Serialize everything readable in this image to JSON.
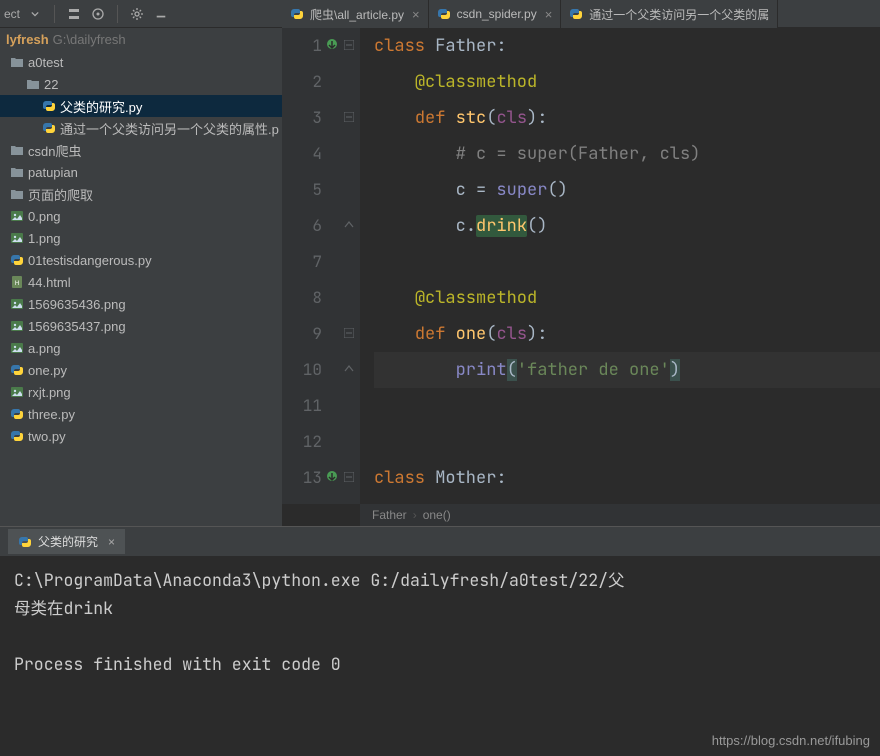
{
  "toolbar": {
    "project_suffix": "ect"
  },
  "tabs": [
    {
      "label": "爬虫\\all_article.py",
      "icon": "python",
      "closable": true
    },
    {
      "label": "csdn_spider.py",
      "icon": "python",
      "closable": true
    },
    {
      "label": "通过一个父类访问另一个父类的属",
      "icon": "python",
      "closable": false
    }
  ],
  "project": {
    "root_name": "lyfresh",
    "root_path": "G:\\dailyfresh",
    "tree": [
      {
        "indent": 0,
        "icon": "folder",
        "label": "a0test"
      },
      {
        "indent": 1,
        "icon": "folder",
        "label": "22"
      },
      {
        "indent": 2,
        "icon": "python",
        "label": "父类的研究.py",
        "selected": true
      },
      {
        "indent": 2,
        "icon": "python",
        "label": "通过一个父类访问另一个父类的属性.p"
      },
      {
        "indent": 0,
        "icon": "folder",
        "label": "csdn爬虫"
      },
      {
        "indent": 0,
        "icon": "folder",
        "label": "patupian"
      },
      {
        "indent": 0,
        "icon": "folder",
        "label": "页面的爬取"
      },
      {
        "indent": 0,
        "icon": "image",
        "label": "0.png"
      },
      {
        "indent": 0,
        "icon": "image",
        "label": "1.png"
      },
      {
        "indent": 0,
        "icon": "python",
        "label": "01testisdangerous.py"
      },
      {
        "indent": 0,
        "icon": "html",
        "label": "44.html"
      },
      {
        "indent": 0,
        "icon": "image",
        "label": "1569635436.png"
      },
      {
        "indent": 0,
        "icon": "image",
        "label": "1569635437.png"
      },
      {
        "indent": 0,
        "icon": "image",
        "label": "a.png"
      },
      {
        "indent": 0,
        "icon": "python",
        "label": "one.py"
      },
      {
        "indent": 0,
        "icon": "image",
        "label": "rxjt.png"
      },
      {
        "indent": 0,
        "icon": "python",
        "label": "three.py"
      },
      {
        "indent": 0,
        "icon": "python",
        "label": "two.py"
      }
    ]
  },
  "code": {
    "gutter_first": 1,
    "lines": [
      {
        "n": 1,
        "mark": "impl",
        "fold": "minus",
        "html": "<span class='k'>class</span> <span class='pa'>Father</span><span class='pu'>:</span>"
      },
      {
        "n": 2,
        "html": "    <span class='dec'>@classmethod</span>"
      },
      {
        "n": 3,
        "fold": "minus",
        "html": "    <span class='k'>def</span> <span class='fn'>stc</span><span class='pu'>(</span><span class='se'>cls</span><span class='pu'>):</span>"
      },
      {
        "n": 4,
        "html": "        <span class='cm'># c = super(Father, cls)</span>"
      },
      {
        "n": 5,
        "html": "        <span class='pa'>c</span> <span class='op'>=</span> <span class='bi'>super</span><span class='pu'>()</span>"
      },
      {
        "n": 6,
        "fold": "up",
        "html": "        <span class='pa'>c</span><span class='pu'>.</span><span class='fn hl-ident'>drink</span><span class='pu'>()</span>"
      },
      {
        "n": 7,
        "html": ""
      },
      {
        "n": 8,
        "html": "    <span class='dec'>@classmethod</span>"
      },
      {
        "n": 9,
        "fold": "minus",
        "html": "    <span class='k'>def</span> <span class='fn'>one</span><span class='pu'>(</span><span class='se'>cls</span><span class='pu'>):</span>"
      },
      {
        "n": 10,
        "fold": "up",
        "hl": true,
        "html": "        <span class='bi'>print</span><span class='pu caret-br'>(</span><span class='st'>'father de one'</span><span class='pu caret-br'>)</span>"
      },
      {
        "n": 11,
        "html": ""
      },
      {
        "n": 12,
        "html": ""
      },
      {
        "n": 13,
        "mark": "impl",
        "fold": "minus",
        "html": "<span class='k'>class</span> <span class='pa'>Mother</span><span class='pu'>:</span>"
      }
    ]
  },
  "breadcrumb": {
    "items": [
      "Father",
      "one()"
    ]
  },
  "run": {
    "tab_label": "父类的研究",
    "output": "C:\\ProgramData\\Anaconda3\\python.exe G:/dailyfresh/a0test/22/父\n母类在drink\n\nProcess finished with exit code 0"
  },
  "watermark": "https://blog.csdn.net/ifubing"
}
